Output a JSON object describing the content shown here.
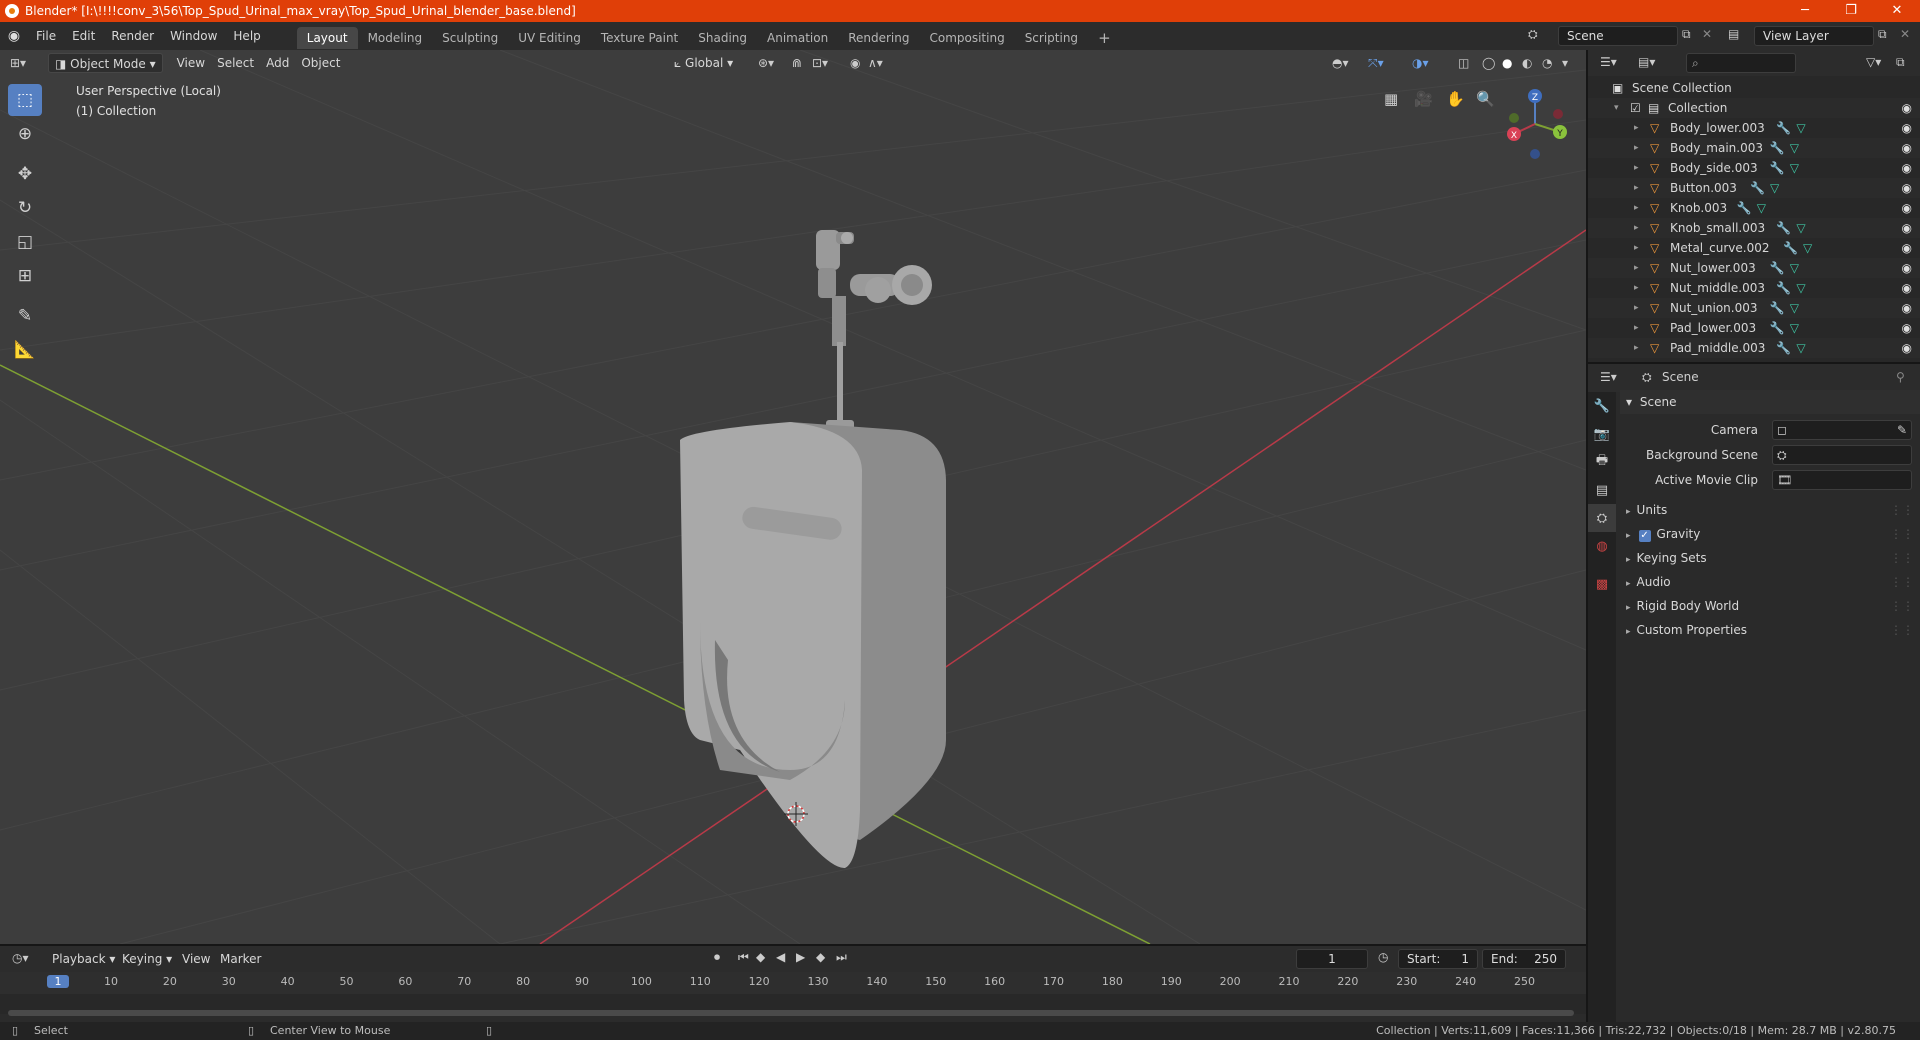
{
  "window": {
    "title": "Blender* [I:\\!!!!conv_3\\56\\Top_Spud_Urinal_max_vray\\Top_Spud_Urinal_blender_base.blend]",
    "minimize": "─",
    "maximize": "❐",
    "close": "✕"
  },
  "menu": [
    "File",
    "Edit",
    "Render",
    "Window",
    "Help"
  ],
  "workspaces": [
    "Layout",
    "Modeling",
    "Sculpting",
    "UV Editing",
    "Texture Paint",
    "Shading",
    "Animation",
    "Rendering",
    "Compositing",
    "Scripting"
  ],
  "workspace_add": "+",
  "scene_field": "Scene",
  "view_layer_field": "View Layer",
  "viewport_header": {
    "mode": "Object Mode",
    "menus": [
      "View",
      "Select",
      "Add",
      "Object"
    ],
    "orientation": "Global"
  },
  "viewport": {
    "perspective_label": "User Perspective (Local)",
    "collection_label": "(1) Collection",
    "gizmo": {
      "x": "X",
      "y": "Y",
      "z": "Z"
    }
  },
  "outliner": {
    "search_placeholder": "",
    "root": "Scene Collection",
    "collection": "Collection",
    "items": [
      "Body_lower.003",
      "Body_main.003",
      "Body_side.003",
      "Button.003",
      "Knob.003",
      "Knob_small.003",
      "Metal_curve.002",
      "Nut_lower.003",
      "Nut_middle.003",
      "Nut_union.003",
      "Pad_lower.003",
      "Pad_middle.003"
    ]
  },
  "properties": {
    "header": "Scene",
    "section": "Scene",
    "camera_label": "Camera",
    "background_scene_label": "Background Scene",
    "active_movie_clip_label": "Active Movie Clip",
    "panels": [
      "Units",
      "Gravity",
      "Keying Sets",
      "Audio",
      "Rigid Body World",
      "Custom Properties"
    ],
    "gravity_checked": true
  },
  "timeline": {
    "menus": [
      "Playback",
      "Keying",
      "View",
      "Marker"
    ],
    "current_frame": "1",
    "start_label": "Start:",
    "start_value": "1",
    "end_label": "End:",
    "end_value": "250",
    "ticks": [
      "1",
      "10",
      "20",
      "30",
      "40",
      "50",
      "60",
      "70",
      "80",
      "90",
      "100",
      "110",
      "120",
      "130",
      "140",
      "150",
      "160",
      "170",
      "180",
      "190",
      "200",
      "210",
      "220",
      "230",
      "240",
      "250"
    ]
  },
  "status": {
    "left_action": "Select",
    "middle_action": "Center View to Mouse",
    "stats": "Collection | Verts:11,609 | Faces:11,366 | Tris:22,732 | Objects:0/18 | Mem: 28.7 MB | v2.80.75"
  },
  "colors": {
    "title_bar": "#e03f08",
    "accent": "#5680c2",
    "x_axis": "#b83a48",
    "y_axis": "#7ea033",
    "mesh_icon": "#e8943a",
    "modifier_icon": "#6aa0e8",
    "data_icon": "#3ec4a2"
  }
}
